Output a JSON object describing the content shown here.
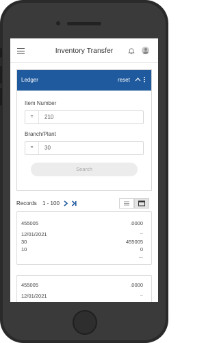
{
  "app": {
    "title": "Inventory Transfer"
  },
  "panel": {
    "title": "Ledger",
    "reset_label": "reset",
    "fields": [
      {
        "label": "Item Number",
        "operator": "=",
        "value": "210"
      },
      {
        "label": "Branch/Plant",
        "operator": "=",
        "value": "30"
      }
    ],
    "search_label": "Search"
  },
  "records": {
    "label": "Records",
    "range": "1 - 100"
  },
  "cards": [
    {
      "left": [
        "455005",
        "12/01/2021",
        "30",
        "10"
      ],
      "right": [
        ".0000",
        "..",
        "455005",
        "0",
        "..."
      ]
    },
    {
      "left": [
        "455005",
        "12/01/2021"
      ],
      "right": [
        ".0000",
        ".."
      ]
    }
  ],
  "colors": {
    "header_bar": "#1f5a9e",
    "accent": "#1f5a9e"
  },
  "icons": [
    "menu-icon",
    "bell-icon",
    "user-avatar-icon",
    "chevron-up-icon",
    "kebab-menu-icon",
    "next-page-icon",
    "last-page-icon",
    "list-view-icon",
    "card-view-icon"
  ]
}
